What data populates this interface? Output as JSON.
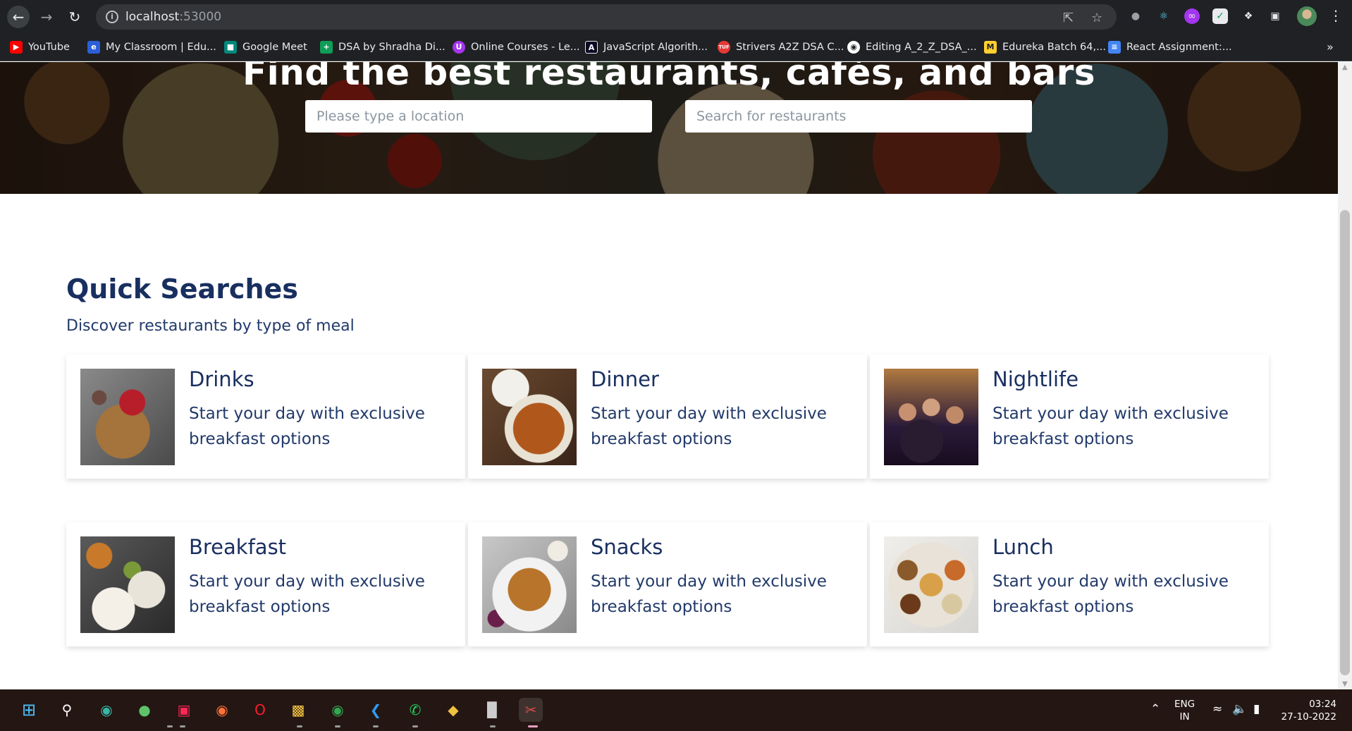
{
  "browser": {
    "url_host": "localhost",
    "url_port": ":53000",
    "nav": {
      "back_icon": "arrow-left-icon",
      "forward_icon": "arrow-right-icon",
      "reload_icon": "reload-icon"
    }
  },
  "bookmarks": [
    {
      "label": "YouTube",
      "icon": "youtube-icon",
      "color": "#ff0000"
    },
    {
      "label": "My Classroom | Edu...",
      "icon": "edureka-icon",
      "color": "#2b5fd9"
    },
    {
      "label": "Google Meet",
      "icon": "google-meet-icon",
      "color": "#00897b"
    },
    {
      "label": "DSA by Shradha Di...",
      "icon": "google-sheets-icon",
      "color": "#0f9d58"
    },
    {
      "label": "Online Courses - Le...",
      "icon": "udemy-icon",
      "color": "#a435f0"
    },
    {
      "label": "JavaScript Algorith...",
      "icon": "freecodecamp-icon",
      "color": "#0a0a23"
    },
    {
      "label": "Strivers A2Z DSA C...",
      "icon": "takeuforward-icon",
      "color": "#e53935"
    },
    {
      "label": "Editing A_2_Z_DSA_...",
      "icon": "github-icon",
      "color": "#ffffff"
    },
    {
      "label": "Edureka Batch 64,...",
      "icon": "miro-icon",
      "color": "#ffd02f"
    },
    {
      "label": "React Assignment:...",
      "icon": "google-docs-icon",
      "color": "#4285f4"
    }
  ],
  "hero": {
    "title": "Find the best restaurants, cafés, and bars",
    "location_placeholder": "Please type a location",
    "restaurant_placeholder": "Search for restaurants"
  },
  "quick_searches": {
    "title": "Quick Searches",
    "subtitle": "Discover restaurants by type of meal",
    "items": [
      {
        "title": "Drinks",
        "description": "Start your day with exclusive breakfast options"
      },
      {
        "title": "Dinner",
        "description": "Start your day with exclusive breakfast options"
      },
      {
        "title": "Nightlife",
        "description": "Start your day with exclusive breakfast options"
      },
      {
        "title": "Breakfast",
        "description": "Start your day with exclusive breakfast options"
      },
      {
        "title": "Snacks",
        "description": "Start your day with exclusive breakfast options"
      },
      {
        "title": "Lunch",
        "description": "Start your day with exclusive breakfast options"
      }
    ]
  },
  "taskbar": {
    "lang_line1": "ENG",
    "lang_line2": "IN",
    "time": "03:24",
    "date": "27-10-2022"
  }
}
